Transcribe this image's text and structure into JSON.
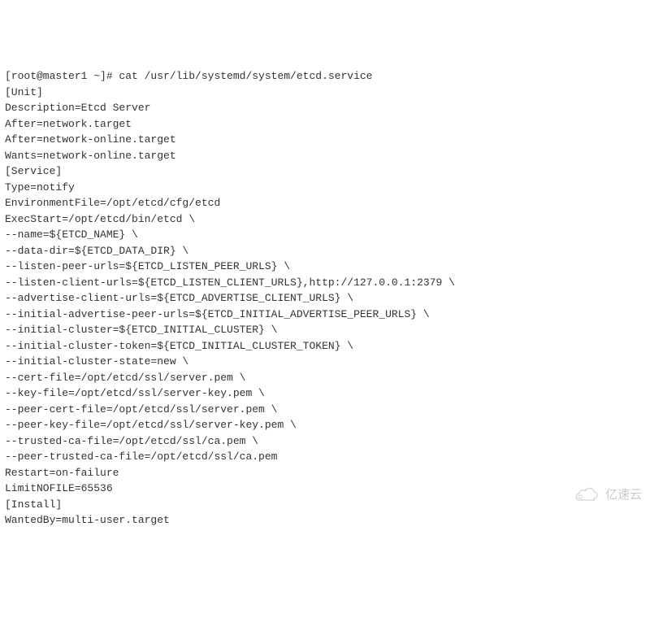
{
  "terminal": {
    "lines": [
      "[root@master1 ~]# cat /usr/lib/systemd/system/etcd.service",
      "[Unit]",
      "Description=Etcd Server",
      "After=network.target",
      "After=network-online.target",
      "Wants=network-online.target",
      "",
      "[Service]",
      "Type=notify",
      "EnvironmentFile=/opt/etcd/cfg/etcd",
      "ExecStart=/opt/etcd/bin/etcd \\",
      "--name=${ETCD_NAME} \\",
      "--data-dir=${ETCD_DATA_DIR} \\",
      "--listen-peer-urls=${ETCD_LISTEN_PEER_URLS} \\",
      "--listen-client-urls=${ETCD_LISTEN_CLIENT_URLS},http://127.0.0.1:2379 \\",
      "--advertise-client-urls=${ETCD_ADVERTISE_CLIENT_URLS} \\",
      "--initial-advertise-peer-urls=${ETCD_INITIAL_ADVERTISE_PEER_URLS} \\",
      "--initial-cluster=${ETCD_INITIAL_CLUSTER} \\",
      "--initial-cluster-token=${ETCD_INITIAL_CLUSTER_TOKEN} \\",
      "--initial-cluster-state=new \\",
      "--cert-file=/opt/etcd/ssl/server.pem \\",
      "--key-file=/opt/etcd/ssl/server-key.pem \\",
      "--peer-cert-file=/opt/etcd/ssl/server.pem \\",
      "--peer-key-file=/opt/etcd/ssl/server-key.pem \\",
      "--trusted-ca-file=/opt/etcd/ssl/ca.pem \\",
      "--peer-trusted-ca-file=/opt/etcd/ssl/ca.pem",
      "Restart=on-failure",
      "LimitNOFILE=65536",
      "",
      "[Install]",
      "WantedBy=multi-user.target"
    ]
  },
  "watermark": {
    "text": "亿速云"
  }
}
